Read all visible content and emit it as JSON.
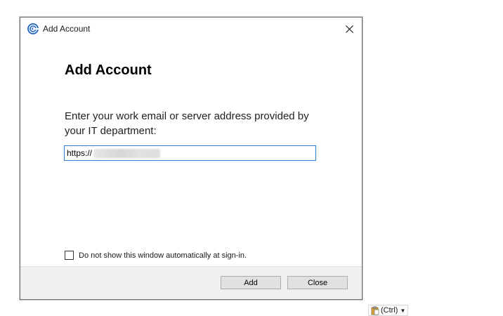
{
  "window": {
    "title": "Add Account",
    "close_icon": "close-icon"
  },
  "dialog": {
    "heading": "Add Account",
    "prompt": "Enter your work email or server address provided by your IT department:",
    "server_input": {
      "value": "https://"
    },
    "checkbox": {
      "label": "Do not show this window automatically at sign-in.",
      "checked": false
    }
  },
  "footer": {
    "add_label": "Add",
    "close_label": "Close"
  },
  "paste_options": {
    "label": "(Ctrl)",
    "icon": "clipboard-icon"
  },
  "colors": {
    "accent": "#2f7bd4",
    "footer_bg": "#f0f0f0",
    "button_bg": "#e1e1e1"
  }
}
